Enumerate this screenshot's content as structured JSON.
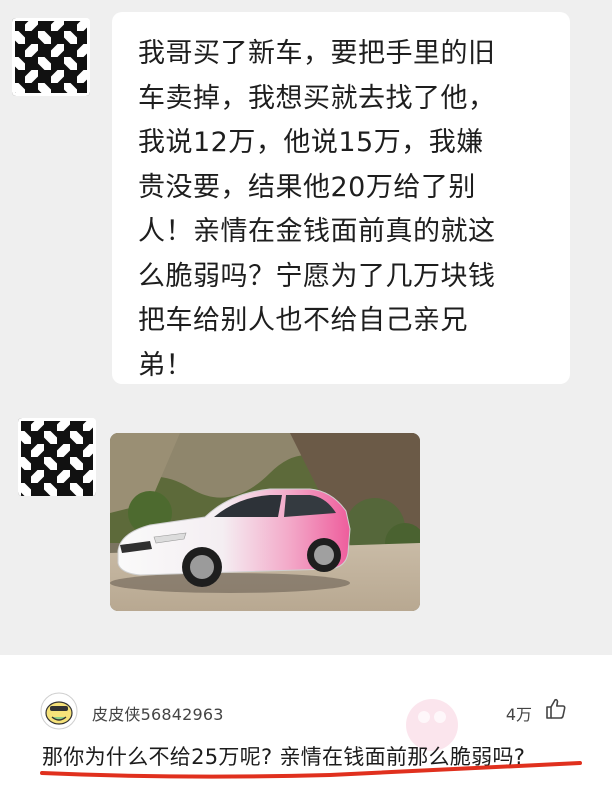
{
  "post": {
    "text": "我哥买了新车，要把手里的旧\n车卖掉，我想买就去找了他，\n我说12万，他说15万，我嫌\n贵没要，结果他20万给了别\n人！亲情在金钱面前真的就这\n么脆弱吗？宁愿为了几万块钱\n把车给别人也不给自己亲兄\n弟！",
    "avatar_icon": "houndstooth-avatar-icon",
    "photo": "white-pink-sedan-photo"
  },
  "comment": {
    "username": "皮皮侠56842963",
    "like_count": "4万",
    "like_icon": "thumbs-up-icon",
    "avatar_icon": "smiley-face-icon",
    "text": "那你为什么不给25万呢? 亲情在钱面前那么脆弱吗?",
    "underline_color": "#e0301e"
  },
  "colors": {
    "chat_background": "#efefef",
    "bubble": "#ffffff",
    "accent_pink": "#f06aa0"
  }
}
